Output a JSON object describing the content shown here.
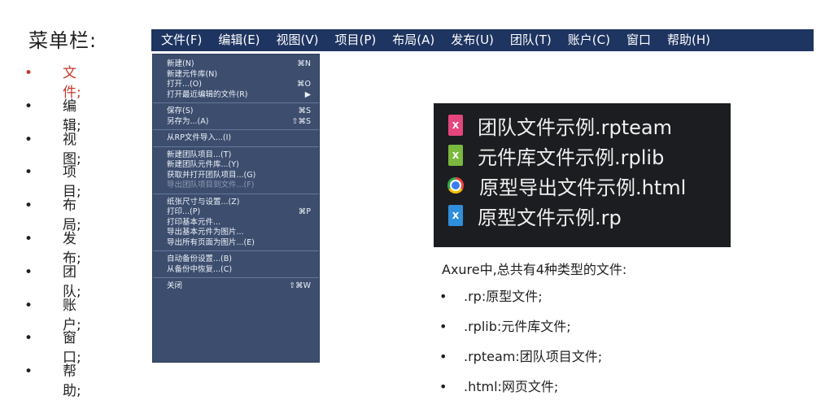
{
  "title": "菜单栏:",
  "left_list": [
    {
      "bullet": "•",
      "label": "文件;"
    },
    {
      "bullet": "•",
      "label": "编辑;"
    },
    {
      "bullet": "•",
      "label": "视图;"
    },
    {
      "bullet": "•",
      "label": "项目;"
    },
    {
      "bullet": "•",
      "label": "布局;"
    },
    {
      "bullet": "•",
      "label": "发布;"
    },
    {
      "bullet": "•",
      "label": "团队;"
    },
    {
      "bullet": "•",
      "label": "账户;"
    },
    {
      "bullet": "•",
      "label": "窗口;"
    },
    {
      "bullet": "•",
      "label": "帮助;"
    }
  ],
  "menubar": [
    "文件(F)",
    "编辑(E)",
    "视图(V)",
    "项目(P)",
    "布局(A)",
    "发布(U)",
    "团队(T)",
    "账户(C)",
    "窗口",
    "帮助(H)"
  ],
  "file_menu": {
    "groups": [
      [
        {
          "label": "新建(N)",
          "shortcut": "⌘N"
        },
        {
          "label": "新建元件库(N)",
          "shortcut": ""
        },
        {
          "label": "打开...(O)",
          "shortcut": "⌘O"
        },
        {
          "label": "打开最近编辑的文件(R)",
          "shortcut": "▶"
        }
      ],
      [
        {
          "label": "保存(S)",
          "shortcut": "⌘S"
        },
        {
          "label": "另存为...(A)",
          "shortcut": "⇧⌘S"
        }
      ],
      [
        {
          "label": "从RP文件导入...(I)",
          "shortcut": ""
        }
      ],
      [
        {
          "label": "新建团队项目...(T)",
          "shortcut": ""
        },
        {
          "label": "新建团队元件库...(Y)",
          "shortcut": ""
        },
        {
          "label": "获取并打开团队项目...(G)",
          "shortcut": ""
        },
        {
          "label": "导出团队项目到文件...(F)",
          "shortcut": "",
          "disabled": true
        }
      ],
      [
        {
          "label": "纸张尺寸与设置...(Z)",
          "shortcut": ""
        },
        {
          "label": "打印...(P)",
          "shortcut": "⌘P"
        },
        {
          "label": "打印基本元件...",
          "shortcut": ""
        },
        {
          "label": "导出基本元件为图片...",
          "shortcut": ""
        },
        {
          "label": "导出所有页面为图片...(E)",
          "shortcut": ""
        }
      ],
      [
        {
          "label": "自动备份设置...(B)",
          "shortcut": ""
        },
        {
          "label": "从备份中恢复...(C)",
          "shortcut": ""
        }
      ],
      [
        {
          "label": "关闭",
          "shortcut": "⇧⌘W"
        }
      ]
    ]
  },
  "files": [
    {
      "name": "团队文件示例.rpteam",
      "icon": "pink-x-file-icon",
      "color": "#e4457d"
    },
    {
      "name": "元件库文件示例.rplib",
      "icon": "green-x-file-icon",
      "color": "#7ab83e"
    },
    {
      "name": "原型导出文件示例.html",
      "icon": "chrome-icon",
      "color": "#3b7ded"
    },
    {
      "name": "原型文件示例.rp",
      "icon": "blue-x-file-icon",
      "color": "#2f8fdc"
    }
  ],
  "description": "Axure中,总共有4种类型的文件:",
  "file_types": [
    {
      "bullet": "•",
      "label": ".rp:原型文件;"
    },
    {
      "bullet": "•",
      "label": ".rplib:元件库文件;"
    },
    {
      "bullet": "•",
      "label": ".rpteam:团队项目文件;"
    },
    {
      "bullet": "•",
      "label": ".html:网页文件;"
    }
  ],
  "colors": {
    "menubar_bg": "#1e3461",
    "dropdown_bg": "#3c4d6e",
    "files_panel_bg": "#1c1d20",
    "active_item": "#c0392b"
  }
}
